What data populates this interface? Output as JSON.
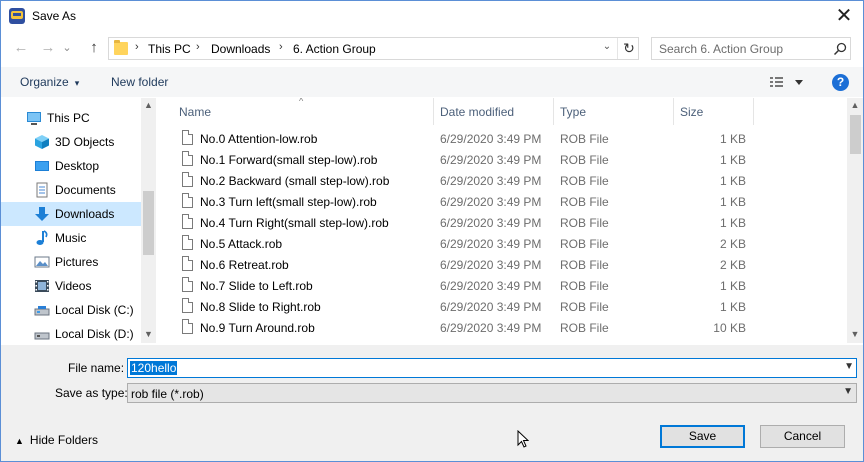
{
  "window": {
    "title": "Save As",
    "close_glyph": "✕"
  },
  "nav": {
    "back_glyph": "←",
    "forward_glyph": "→",
    "recent_glyph": "⌄",
    "up_glyph": "↑"
  },
  "address": {
    "crumbs": [
      "This PC",
      "Downloads",
      "6. Action Group"
    ],
    "separator": "›",
    "dropdown_glyph": "⌄",
    "refresh_glyph": "↻"
  },
  "search": {
    "placeholder": "Search 6. Action Group"
  },
  "toolbar": {
    "organize_label": "Organize",
    "new_folder_label": "New folder",
    "help_label": "?",
    "caret": "▾"
  },
  "sidebar": {
    "items": [
      {
        "label": "This PC",
        "icon": "monitor-icon"
      },
      {
        "label": "3D Objects",
        "icon": "cube-icon"
      },
      {
        "label": "Desktop",
        "icon": "desktop-icon"
      },
      {
        "label": "Documents",
        "icon": "documents-icon"
      },
      {
        "label": "Downloads",
        "icon": "download-arrow-icon",
        "selected": true
      },
      {
        "label": "Music",
        "icon": "music-note-icon"
      },
      {
        "label": "Pictures",
        "icon": "pictures-icon"
      },
      {
        "label": "Videos",
        "icon": "video-icon"
      },
      {
        "label": "Local Disk (C:)",
        "icon": "drive-icon"
      },
      {
        "label": "Local Disk (D:)",
        "icon": "drive-icon"
      }
    ]
  },
  "columns": {
    "name": "Name",
    "date": "Date modified",
    "type": "Type",
    "size": "Size"
  },
  "files": [
    {
      "name": "No.0 Attention-low.rob",
      "date": "6/29/2020 3:49 PM",
      "type": "ROB File",
      "size": "1 KB"
    },
    {
      "name": "No.1 Forward(small step-low).rob",
      "date": "6/29/2020 3:49 PM",
      "type": "ROB File",
      "size": "1 KB"
    },
    {
      "name": "No.2 Backward (small step-low).rob",
      "date": "6/29/2020 3:49 PM",
      "type": "ROB File",
      "size": "1 KB"
    },
    {
      "name": "No.3 Turn left(small step-low).rob",
      "date": "6/29/2020 3:49 PM",
      "type": "ROB File",
      "size": "1 KB"
    },
    {
      "name": "No.4 Turn Right(small step-low).rob",
      "date": "6/29/2020 3:49 PM",
      "type": "ROB File",
      "size": "1 KB"
    },
    {
      "name": "No.5 Attack.rob",
      "date": "6/29/2020 3:49 PM",
      "type": "ROB File",
      "size": "2 KB"
    },
    {
      "name": "No.6 Retreat.rob",
      "date": "6/29/2020 3:49 PM",
      "type": "ROB File",
      "size": "2 KB"
    },
    {
      "name": "No.7 Slide to Left.rob",
      "date": "6/29/2020 3:49 PM",
      "type": "ROB File",
      "size": "1 KB"
    },
    {
      "name": "No.8 Slide to Right.rob",
      "date": "6/29/2020 3:49 PM",
      "type": "ROB File",
      "size": "1 KB"
    },
    {
      "name": "No.9 Turn Around.rob",
      "date": "6/29/2020 3:49 PM",
      "type": "ROB File",
      "size": "10 KB"
    }
  ],
  "form": {
    "file_name_label": "File name:",
    "file_name_value": "120hello",
    "save_type_label": "Save as type:",
    "save_type_value": "rob file (*.rob)"
  },
  "footer": {
    "hide_folders_label": "Hide Folders",
    "save_label": "Save",
    "cancel_label": "Cancel"
  },
  "colors": {
    "accent": "#0078d7",
    "selected_bg": "#cce8ff",
    "bottom_bg": "#f0f0f0"
  }
}
